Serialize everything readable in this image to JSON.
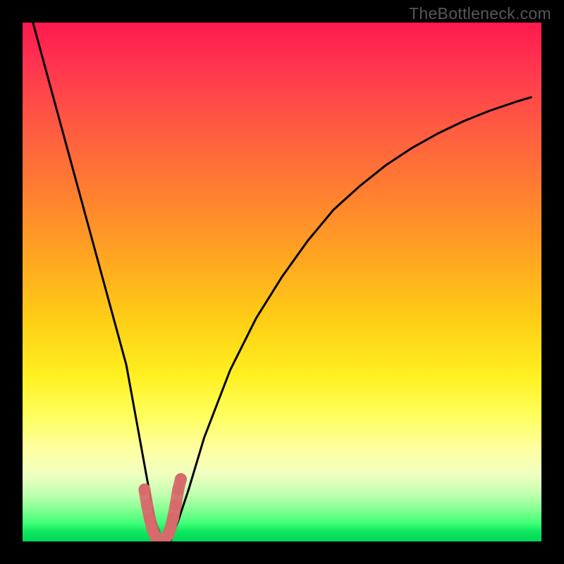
{
  "watermark": "TheBottleneck.com",
  "chart_data": {
    "type": "line",
    "title": "",
    "xlabel": "",
    "ylabel": "",
    "xlim": [
      0,
      100
    ],
    "ylim": [
      0,
      100
    ],
    "background_gradient": {
      "top": "#ff1a4d",
      "mid": "#ffd015",
      "bottom": "#00d858"
    },
    "series": [
      {
        "name": "bottleneck-curve",
        "color": "#000000",
        "x": [
          2,
          5,
          8,
          11,
          14,
          17,
          20,
          22,
          24,
          25.5,
          27,
          28.5,
          30,
          32,
          35,
          40,
          45,
          50,
          55,
          60,
          65,
          70,
          75,
          80,
          85,
          90,
          95,
          98
        ],
        "y": [
          100,
          89,
          78,
          67,
          56,
          45,
          34,
          23,
          12,
          4,
          0,
          0,
          4,
          10,
          20,
          33,
          43,
          51,
          58,
          64,
          68.5,
          72.5,
          75.8,
          78.6,
          81,
          83,
          84.7,
          85.6
        ]
      },
      {
        "name": "valley-marker",
        "color": "#d76a6a",
        "type": "scatter",
        "x": [
          23.5,
          24.0,
          24.5,
          25.0,
          25.5,
          26.0,
          26.5,
          27.0,
          27.5,
          28.0,
          28.5,
          29.0,
          29.5,
          30.0,
          30.5
        ],
        "y": [
          10.0,
          7.0,
          4.5,
          2.5,
          1.2,
          0.5,
          0.2,
          0.2,
          0.5,
          1.2,
          2.5,
          4.5,
          7.0,
          10.0,
          12.0
        ]
      }
    ]
  }
}
